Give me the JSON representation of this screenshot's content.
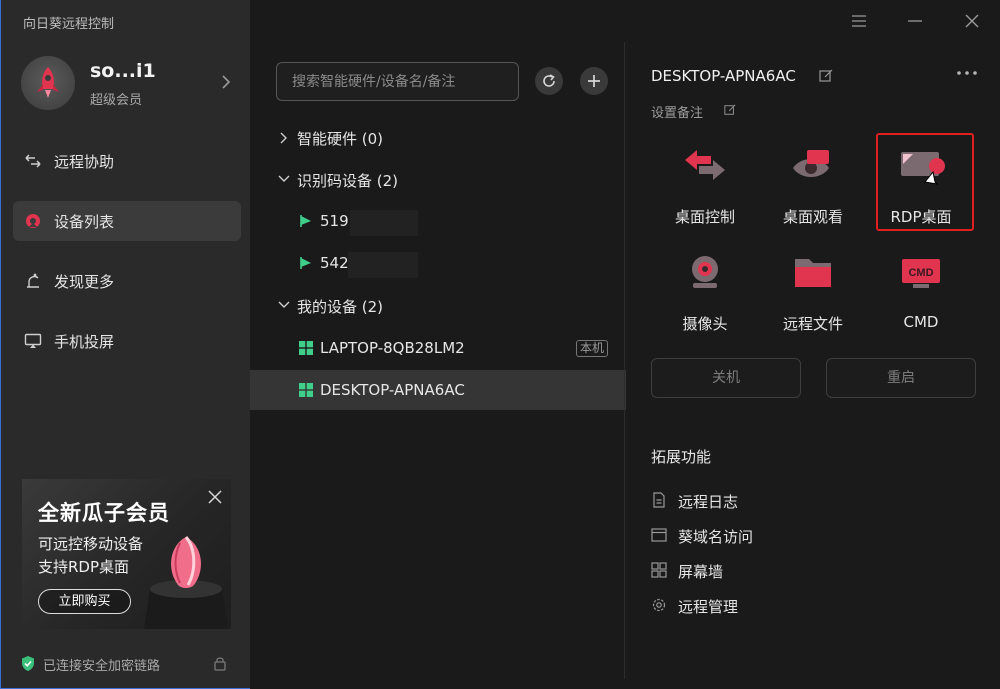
{
  "app": {
    "title": "向日葵远程控制"
  },
  "profile": {
    "name": "so...i1",
    "level": "超级会员"
  },
  "nav": {
    "items": [
      {
        "label": "远程协助",
        "icon": "remote-assist-icon"
      },
      {
        "label": "设备列表",
        "icon": "device-list-icon",
        "active": true
      },
      {
        "label": "发现更多",
        "icon": "discover-icon"
      },
      {
        "label": "手机投屏",
        "icon": "screen-cast-icon"
      }
    ]
  },
  "promo": {
    "title": "全新瓜子会员",
    "line1": "可远控移动设备",
    "line2": "支持RDP桌面",
    "button": "立即购买"
  },
  "status": {
    "secure_text": "已连接安全加密链路"
  },
  "search": {
    "placeholder": "搜索智能硬件/设备名/备注",
    "value": ""
  },
  "tree": {
    "groups": [
      {
        "label": "智能硬件 (0)",
        "expanded": false
      },
      {
        "label": "识别码设备 (2)",
        "expanded": true
      },
      {
        "label": "我的设备 (2)",
        "expanded": true
      }
    ],
    "code_devices": [
      {
        "label": "519"
      },
      {
        "label": "542"
      }
    ],
    "my_devices": [
      {
        "label": "LAPTOP-8QB28LM2",
        "tag": "本机"
      },
      {
        "label": "DESKTOP-APNA6AC",
        "selected": true
      }
    ]
  },
  "detail": {
    "device_name": "DESKTOP-APNA6AC",
    "remark": "设置备注",
    "actions": [
      {
        "label": "桌面控制",
        "icon": "desktop-control-icon"
      },
      {
        "label": "桌面观看",
        "icon": "desktop-view-icon"
      },
      {
        "label": "RDP桌面",
        "icon": "rdp-desktop-icon",
        "highlighted": true
      },
      {
        "label": "摄像头",
        "icon": "camera-icon"
      },
      {
        "label": "远程文件",
        "icon": "remote-file-icon"
      },
      {
        "label": "CMD",
        "icon": "cmd-icon"
      }
    ],
    "shutdown": "关机",
    "restart": "重启",
    "extensions_title": "拓展功能",
    "extensions": [
      {
        "label": "远程日志",
        "icon": "log-icon"
      },
      {
        "label": "葵域名访问",
        "icon": "domain-icon"
      },
      {
        "label": "屏幕墙",
        "icon": "screen-wall-icon"
      },
      {
        "label": "远程管理",
        "icon": "settings-icon"
      }
    ]
  },
  "colors": {
    "accent": "#e0344f",
    "highlight": "#e02020",
    "secure": "#3bbf7a",
    "windows_logo": "#3fcf8a"
  }
}
